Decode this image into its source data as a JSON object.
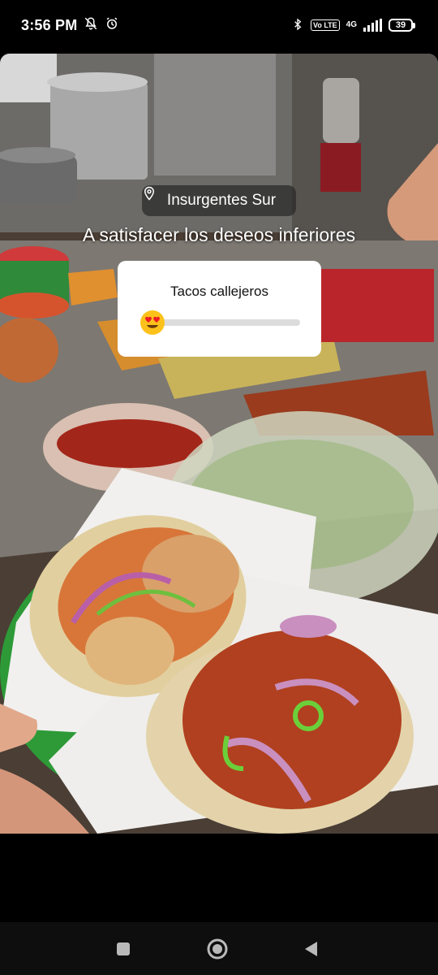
{
  "status_bar": {
    "time": "3:56 PM",
    "network_badge": "Vo LTE",
    "network_type": "4G",
    "battery_level": "39",
    "icons": [
      "notifications-muted-icon",
      "alarm-icon",
      "bluetooth-icon",
      "signal-icon",
      "battery-icon"
    ]
  },
  "story": {
    "location_label": "Insurgentes Sur",
    "caption": "A satisfacer los deseos inferiores",
    "slider": {
      "question": "Tacos callejeros",
      "emoji": "heart-eyes-emoji",
      "value": 0
    }
  },
  "nav": {
    "icons": [
      "recents-square-icon",
      "home-circle-icon",
      "back-triangle-icon"
    ]
  }
}
